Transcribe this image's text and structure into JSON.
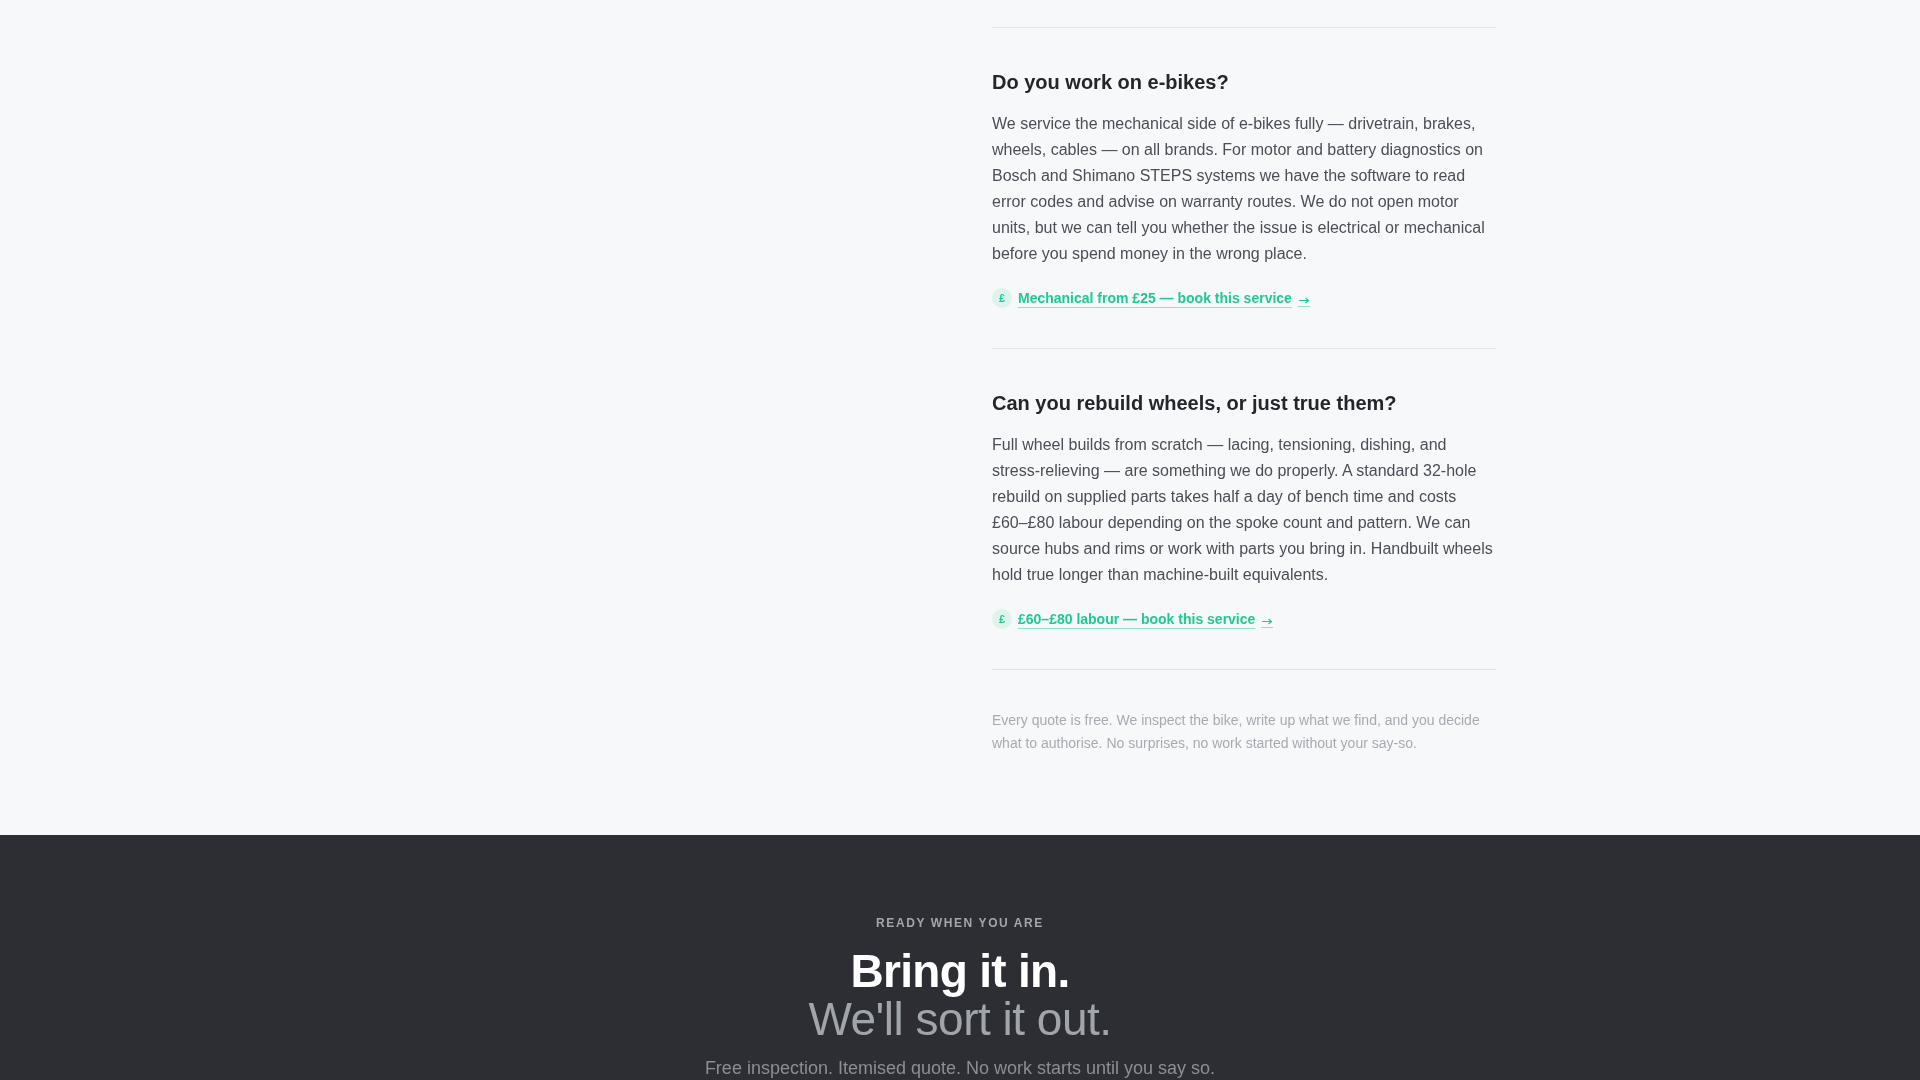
{
  "faq": [
    {
      "question": "Do you work on e-bikes?",
      "answer": "We service the mechanical side of e-bikes fully — drivetrain, brakes, wheels, cables — on all brands. For motor and battery diagnostics on Bosch and Shimano STEPS systems we have the software to read error codes and advise on warranty routes. We do not open motor units, but we can tell you whether the issue is electrical or mechanical before you spend money in the wrong place.",
      "price_icon": "£",
      "link": "Mechanical from £25 — book this service"
    },
    {
      "question": "Can you rebuild wheels, or just true them?",
      "answer": "Full wheel builds from scratch — lacing, tensioning, dishing, and stress-relieving — are something we do properly. A standard 32-hole rebuild on supplied parts takes half a day of bench time and costs £60–£80 labour depending on the spoke count and pattern. We can source hubs and rims or work with parts you bring in. Handbuilt wheels hold true longer than machine-built equivalents.",
      "price_icon": "£",
      "link": "£60–£80 labour — book this service"
    }
  ],
  "footnote": "Every quote is free. We inspect the bike, write up what we find, and you decide what to authorise. No surprises, no work started without your say-so.",
  "cta": {
    "eyebrow": "READY WHEN YOU ARE",
    "headline": "Bring it in.",
    "headline_second": "We'll sort it out.",
    "subtitle": "Free inspection. Itemised quote. No work starts until you say so."
  }
}
